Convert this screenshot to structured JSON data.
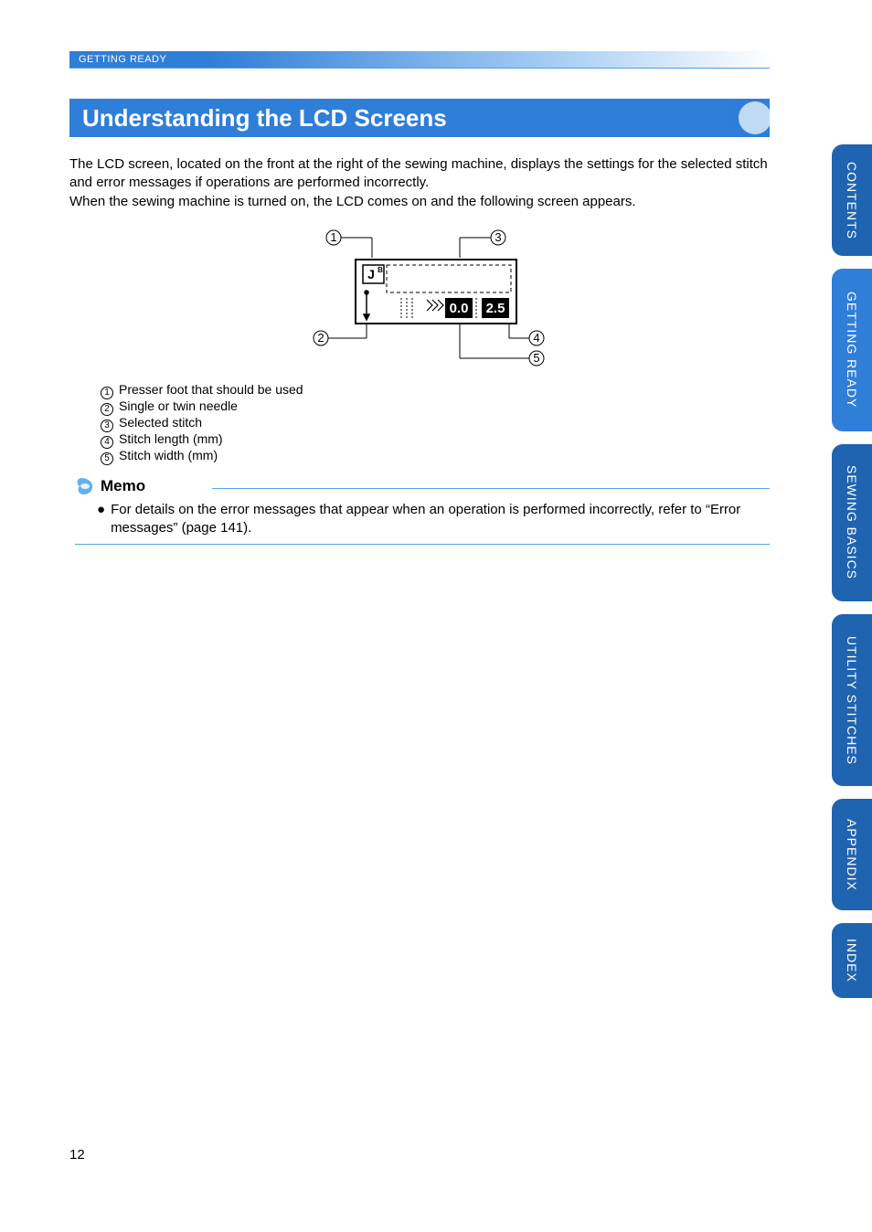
{
  "breadcrumb": "GETTING READY",
  "section_title": "Understanding the LCD Screens",
  "intro": {
    "p1": "The LCD screen, located on the front at the right of the sewing machine, displays the settings for the selected stitch and error messages if operations are performed incorrectly.",
    "p2": "When the sewing machine is turned on, the LCD comes on and the following screen appears."
  },
  "figure": {
    "callouts": {
      "c1": "1",
      "c2": "2",
      "c3": "3",
      "c4": "4",
      "c5": "5"
    },
    "lcd": {
      "foot_letter_top": "J",
      "foot_letter_small": "B",
      "value_left": "0.0",
      "value_right": "2.5"
    }
  },
  "legend": {
    "l1": "Presser foot that should be used",
    "l2": "Single or twin needle",
    "l3": "Selected stitch",
    "l4": "Stitch length (mm)",
    "l5": "Stitch width (mm)"
  },
  "memo": {
    "title": "Memo",
    "body": "For details on the error messages that appear when an operation is performed incorrectly, refer to “Error messages” (page 141)."
  },
  "tabs": {
    "t1": "CONTENTS",
    "t2": "GETTING READY",
    "t3": "SEWING BASICS",
    "t4": "UTILITY STITCHES",
    "t5": "APPENDIX",
    "t6": "INDEX"
  },
  "page_number": "12"
}
